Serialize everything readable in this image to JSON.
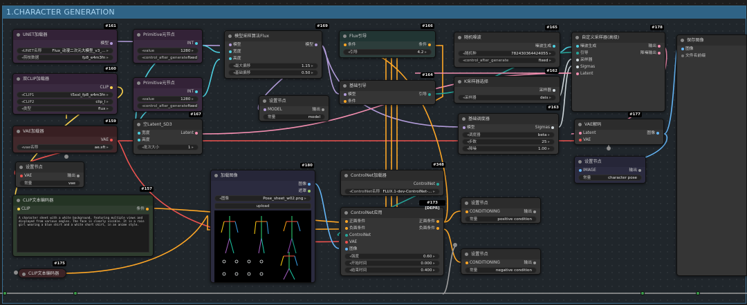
{
  "group": {
    "title": "1.CHARACTER GENERATION"
  },
  "colors": {
    "model": "#b39ddb",
    "clip": "#ffd54f",
    "vae": "#ef5350",
    "latent": "#f48fb1",
    "conditioning": "#ffa726",
    "image": "#64b5f6",
    "sigmas": "#cfd8dc",
    "int": "#4dd0e1",
    "control": "#26a69a"
  },
  "unet": {
    "badge": "#161",
    "title": "UNET加载器",
    "out": "模型",
    "w1_label": "UNET名称",
    "w1_value": "Flux_动漫二次元大模型_v3_...",
    "w2_label": "剪枝数据",
    "w2_value": "fp8_e4m3fn"
  },
  "dualclip": {
    "badge": "#160",
    "title": "双CLIP加载器",
    "out": "CLIP",
    "w1_label": "CLIP1",
    "w1_value": "t5xxl_fp8_e4m3fn",
    "w2_label": "CLIP2",
    "w2_value": "clip_l",
    "w3_label": "类型",
    "w3_value": "flux"
  },
  "vaeloader": {
    "badge": "#159",
    "title": "VAE加载器",
    "out": "VAE",
    "w1_label": "vae名称",
    "w1_value": "ae.sft"
  },
  "setnode_vae": {
    "title": "设置节点",
    "in": "VAE",
    "out": "输出",
    "w1_label": "常量",
    "w1_value": "vae"
  },
  "clipenc": {
    "badge": "#157",
    "title": "CLIP文本编码器",
    "in": "CLIP",
    "out": "条件",
    "text": "A character sheet with a white background, featuring multiple views and displayed from various angles. The face is clearly visible. It is a rain girl wearing a blue shirt and a white short skirt, in an anime style."
  },
  "clipenc2": {
    "badge": "#175",
    "title": "CLIP文本编码器"
  },
  "prim1": {
    "title": "Primitive元节点",
    "out": "INT",
    "w1_label": "value",
    "w1_value": "1280",
    "w2_label": "control_after_generate",
    "w2_value": "fixed"
  },
  "prim2": {
    "badge": "#167",
    "title": "Primitive元节点",
    "out": "INT",
    "w1_label": "value",
    "w1_value": "1280",
    "w2_label": "control_after_generate",
    "w2_value": "fixed"
  },
  "emptylatent": {
    "title": "空Latent_SD3",
    "in1": "宽度",
    "in2": "高度",
    "out": "Latent",
    "w1_label": "批次大小",
    "w1_value": "1"
  },
  "modelsampling": {
    "badge": "#169",
    "title": "模型采样算法Flux",
    "in1": "模型",
    "in2": "宽度",
    "in3": "高度",
    "out": "模型",
    "w1_label": "最大偏移",
    "w1_value": "1.15",
    "w2_label": "基础偏移",
    "w2_value": "0.50"
  },
  "setnode_model": {
    "title": "设置节点",
    "in": "MODEL",
    "out": "输出",
    "w1_label": "常量",
    "w1_value": "model"
  },
  "fluxguide": {
    "badge": "#166",
    "title": "Flux引导",
    "in": "条件",
    "out": "条件",
    "w1_label": "引导",
    "w1_value": "4.2"
  },
  "basicguide": {
    "badge": "#164",
    "title": "基础引导",
    "in1": "模型",
    "in2": "条件",
    "out": "引导"
  },
  "noise": {
    "badge": "#165",
    "title": "随机噪波",
    "out": "噪波生成",
    "w1_label": "随机种",
    "w1_value": "782430364424055",
    "w2_label": "control_after_generate",
    "w2_value": "fixed"
  },
  "ksamplerselect": {
    "badge": "#162",
    "title": "K采样器选择",
    "out": "采样器",
    "w1_label": "采样器",
    "w1_value": "deis"
  },
  "basicsched": {
    "badge": "#163",
    "title": "基础调度器",
    "in": "模型",
    "out": "Sigmas",
    "w1_label": "调度器",
    "w1_value": "beta",
    "w2_label": "步数",
    "w2_value": "25",
    "w3_label": "降噪",
    "w3_value": "1.00"
  },
  "customsampler": {
    "badge": "#178",
    "title": "自定义采样器(高级)",
    "in1": "噪波生成",
    "in2": "引导",
    "in3": "采样器",
    "in4": "Sigmas",
    "in5": "Latent",
    "out1": "输出",
    "out2": "降噪输出"
  },
  "vaedecode": {
    "badge": "#177",
    "title": "VAE解码",
    "in1": "Latent",
    "in2": "VAE",
    "out": "图像"
  },
  "setnode_image": {
    "title": "设置节点",
    "in": "IMAGE",
    "out": "输出",
    "w1_label": "常量",
    "w1_value": "character pose"
  },
  "saveimage": {
    "title": "保存图像",
    "in": "图像",
    "w1_label": "文件名前缀"
  },
  "loadimage": {
    "badge": "#180",
    "title": "加载图像",
    "out1": "图像",
    "out2": "遮罩",
    "w1_label": "图像",
    "w1_value": "Pose_sheet_w02.png",
    "upload": "upload"
  },
  "cnloader": {
    "badge": "#348",
    "title": "ControlNet加载器",
    "out": "ControlNet",
    "w1_label": "ControlNet名称",
    "w1_value": "FLUX.1-dev-ControlNet-..."
  },
  "cnapply": {
    "badge": "#173 [DEPR]",
    "title": "ControlNet应用",
    "in1": "正面条件",
    "in2": "负面条件",
    "in3": "ControlNet",
    "in4": "VAE",
    "in5": "图像",
    "out1": "正面条件",
    "out2": "负面条件",
    "w1_label": "强度",
    "w1_value": "0.60",
    "w2_label": "开始时间",
    "w2_value": "0.000",
    "w3_label": "结束时间",
    "w3_value": "0.400"
  },
  "setnode_pos": {
    "title": "设置节点",
    "in": "CONDITIONING",
    "out": "输出",
    "w1_label": "常量",
    "w1_value": "positive condition"
  },
  "setnode_neg": {
    "title": "设置节点",
    "in": "CONDITIONING",
    "out": "输出",
    "w1_label": "常量",
    "w1_value": "negative condition"
  }
}
